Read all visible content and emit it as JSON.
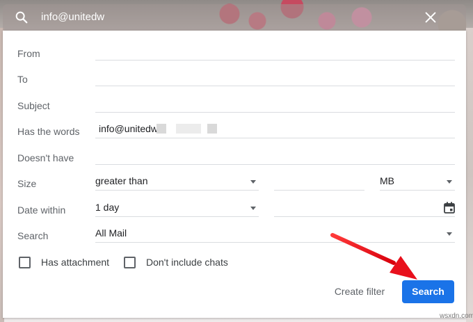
{
  "header": {
    "query": "info@unitedw",
    "search_icon": "search-icon",
    "close_icon": "close-icon"
  },
  "form": {
    "from": {
      "label": "From",
      "value": ""
    },
    "to": {
      "label": "To",
      "value": ""
    },
    "subject": {
      "label": "Subject",
      "value": ""
    },
    "has_words": {
      "label": "Has the words",
      "value": "info@unitedw"
    },
    "doesnt_have": {
      "label": "Doesn't have",
      "value": ""
    },
    "size": {
      "label": "Size",
      "comparator": "greater than",
      "amount": "",
      "unit": "MB"
    },
    "date_within": {
      "label": "Date within",
      "range": "1 day",
      "date": ""
    },
    "search_in": {
      "label": "Search",
      "value": "All Mail"
    },
    "has_attachment": {
      "label": "Has attachment",
      "checked": false
    },
    "dont_include_chats": {
      "label": "Don't include chats",
      "checked": false
    }
  },
  "actions": {
    "create_filter": "Create filter",
    "search": "Search"
  },
  "watermark": "wsxdn.com",
  "colors": {
    "primary": "#1a73e8",
    "annotation_arrow": "#e8101c"
  }
}
